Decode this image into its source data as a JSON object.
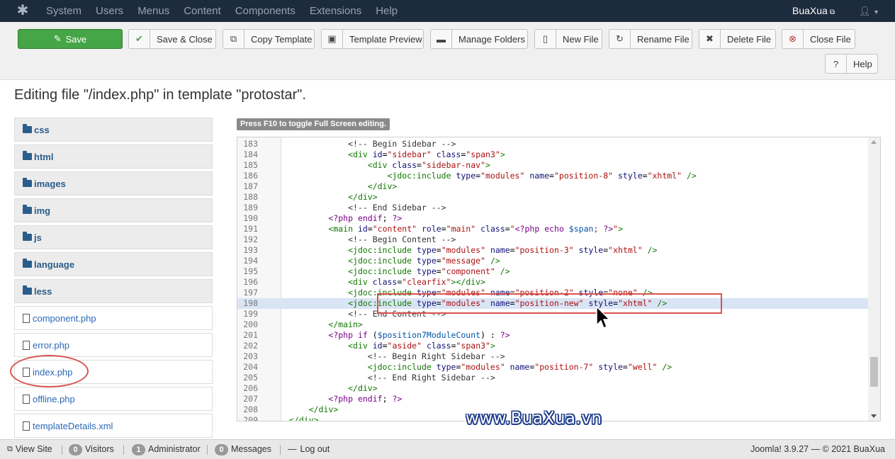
{
  "navbar": {
    "menu": [
      "System",
      "Users",
      "Menus",
      "Content",
      "Components",
      "Extensions",
      "Help"
    ],
    "site_name": "BuaXua",
    "user_icon": "user-icon"
  },
  "toolbar": {
    "save": "Save",
    "save_close": "Save & Close",
    "copy_template": "Copy Template",
    "template_preview": "Template Preview",
    "manage_folders": "Manage Folders",
    "new_file": "New File",
    "rename_file": "Rename File",
    "delete_file": "Delete File",
    "close_file": "Close File",
    "help": "Help"
  },
  "page_title": "Editing file \"/index.php\" in template \"protostar\".",
  "tree": {
    "folders": [
      "css",
      "html",
      "images",
      "img",
      "js",
      "language",
      "less"
    ],
    "files": [
      "component.php",
      "error.php",
      "index.php",
      "offline.php",
      "templateDetails.xml"
    ]
  },
  "editor": {
    "fullscreen_hint": "Press F10 to toggle Full Screen editing.",
    "active_line": "198"
  },
  "watermark": "www.BuaXua.vn",
  "statusbar": {
    "view_site": "View Site",
    "visitors_count": "0",
    "visitors_label": "Visitors",
    "admin_count": "1",
    "admin_label": "Administrator",
    "messages_count": "0",
    "messages_label": "Messages",
    "logout": "Log out",
    "version": "Joomla! 3.9.27  —  © 2021 BuaXua"
  }
}
